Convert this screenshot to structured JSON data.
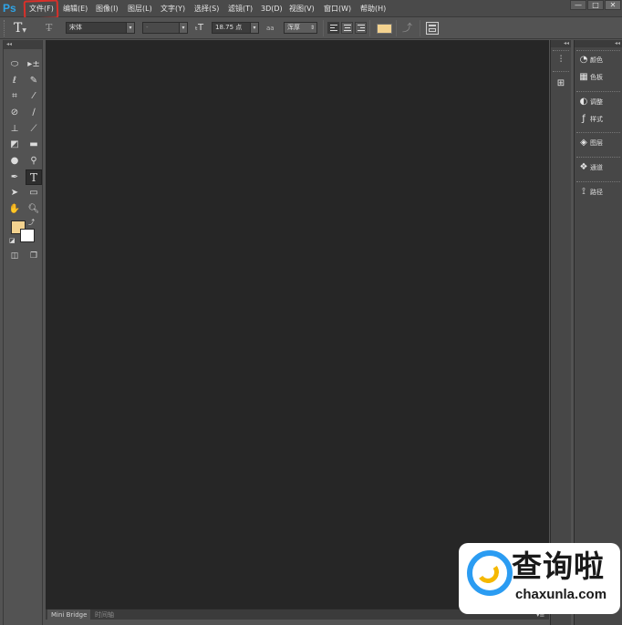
{
  "app": {
    "logo": "Ps"
  },
  "menu": {
    "items": [
      "文件(F)",
      "编辑(E)",
      "图像(I)",
      "图层(L)",
      "文字(Y)",
      "选择(S)",
      "滤镜(T)",
      "3D(D)",
      "视图(V)",
      "窗口(W)",
      "帮助(H)"
    ],
    "highlighted": "文件(F)",
    "highlight_color": "#d9302a"
  },
  "window_controls": {
    "minimize": "—",
    "restore": "□",
    "close": "✕"
  },
  "options_bar": {
    "tool_icon": "T",
    "font_family": "宋体",
    "font_style": "-",
    "font_size": "18.75 点",
    "aa_icon": "aa",
    "anti_alias": "浑厚",
    "text_color": "#f3d28f"
  },
  "toolbox": {
    "tools": [
      "marquee-icon",
      "move-icon",
      "lasso-icon",
      "magic-wand-icon",
      "crop-icon",
      "eyedropper-icon",
      "healing-brush-icon",
      "brush-icon",
      "clone-stamp-icon",
      "history-brush-icon",
      "eraser-icon",
      "gradient-icon",
      "blur-icon",
      "dodge-icon",
      "pen-icon",
      "type-icon",
      "path-selection-icon",
      "rectangle-icon",
      "hand-icon",
      "zoom-icon"
    ],
    "foreground_color": "#f3d28f",
    "background_color": "#ffffff"
  },
  "right_dock": {
    "panels": [
      {
        "icon": "color-icon",
        "label": "颜色"
      },
      {
        "icon": "swatches-icon",
        "label": "色板"
      },
      {
        "icon": "adjustments-icon",
        "label": "调整"
      },
      {
        "icon": "styles-icon",
        "label": "样式"
      },
      {
        "icon": "layers-icon",
        "label": "图层"
      },
      {
        "icon": "channels-icon",
        "label": "通道"
      },
      {
        "icon": "paths-icon",
        "label": "路径"
      }
    ]
  },
  "bottom_tabs": {
    "mini_bridge": "Mini Bridge",
    "timeline": "时间轴"
  },
  "canvas": {
    "background": "#262626"
  },
  "watermark": {
    "title": "查询啦",
    "subtitle": "chaxunla.com"
  }
}
